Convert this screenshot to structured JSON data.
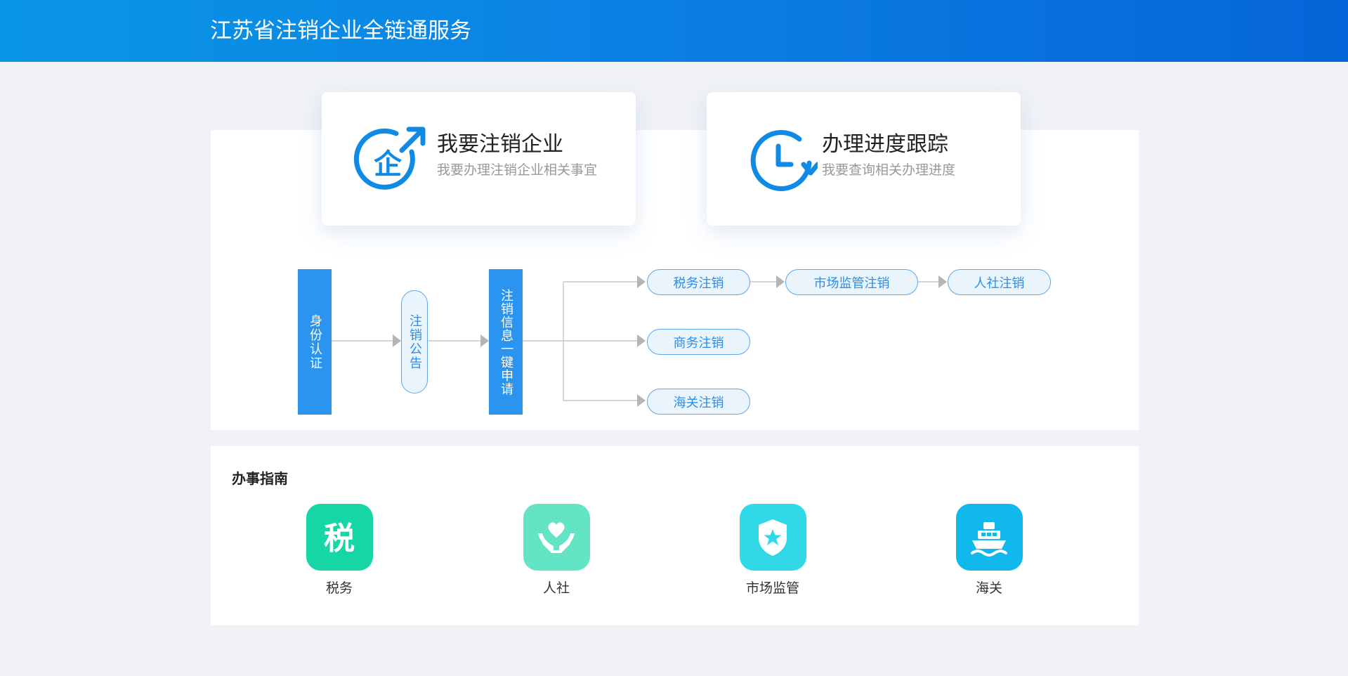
{
  "header": {
    "title": "江苏省注销企业全链通服务"
  },
  "cards": [
    {
      "title": "我要注销企业",
      "desc": "我要办理注销企业相关事宜",
      "icon": "enterprise-cancel-icon"
    },
    {
      "title": "办理进度跟踪",
      "desc": "我要查询相关办理进度",
      "icon": "clock-progress-icon"
    }
  ],
  "flow": {
    "step1": "身份认证",
    "step2": "注销公告",
    "step3": "注销信息一键申请",
    "tax": "税务注销",
    "market": "市场监管注销",
    "hr": "人社注销",
    "commerce": "商务注销",
    "customs": "海关注销"
  },
  "guide": {
    "title": "办事指南",
    "items": [
      {
        "label": "税务",
        "icon": "tax-icon",
        "color": "#17d6a6"
      },
      {
        "label": "人社",
        "icon": "heart-hands-icon",
        "color": "#63e5c5"
      },
      {
        "label": "市场监管",
        "icon": "police-badge-icon",
        "color": "#30d8e8"
      },
      {
        "label": "海关",
        "icon": "ship-icon",
        "color": "#10b8ec"
      }
    ]
  },
  "colors": {
    "header_start": "#0a96e6",
    "header_end": "#0565d8",
    "accent": "#2b94ee",
    "pill_border": "#5aa8ee"
  }
}
